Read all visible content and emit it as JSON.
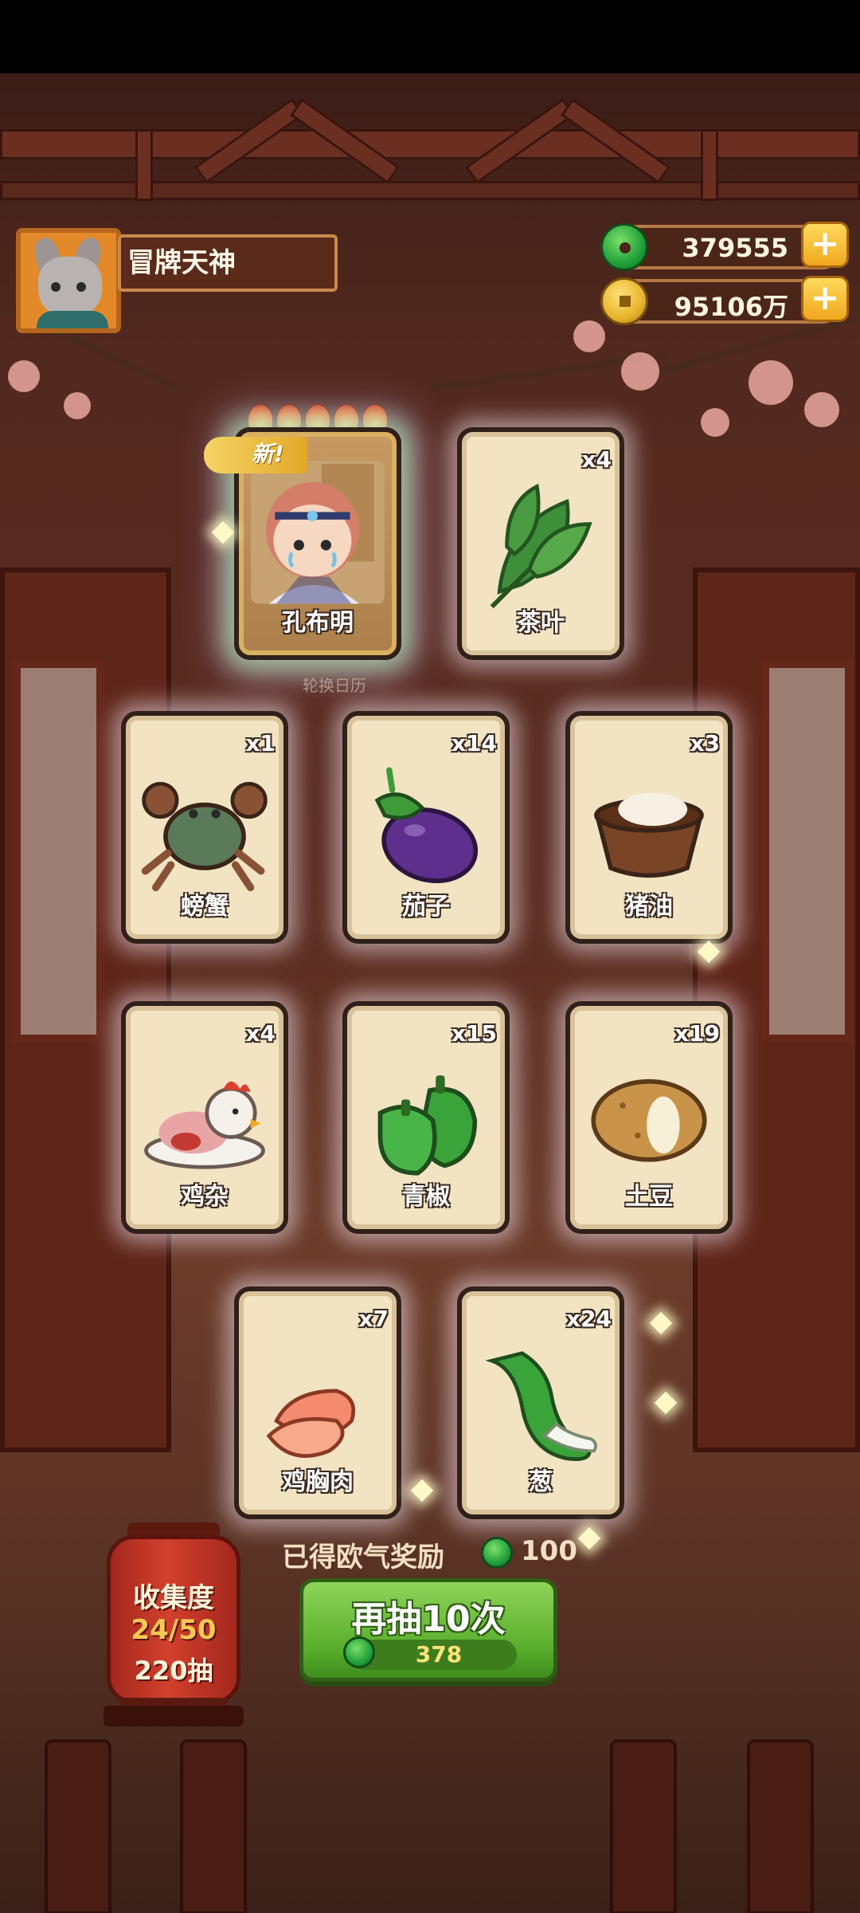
{
  "player": {
    "name": "冒牌天神",
    "avatar_icon": "wolf-avatar-icon"
  },
  "currency": {
    "jade_amount": "379555",
    "coin_amount": "95106万",
    "jade_icon": "jade-icon",
    "coin_icon": "coin-icon",
    "plus_label": "+"
  },
  "new_tag": "新!",
  "background_text": "轮换日历",
  "cards": [
    {
      "id": "kongbuming",
      "label": "孔布明",
      "count": "",
      "is_character": true,
      "is_new": true,
      "stars": 5
    },
    {
      "id": "tea",
      "label": "茶叶",
      "count": "x4",
      "icon": "tea-leaf-icon"
    },
    {
      "id": "crab",
      "label": "螃蟹",
      "count": "x1",
      "icon": "crab-icon"
    },
    {
      "id": "eggplant",
      "label": "茄子",
      "count": "x14",
      "icon": "eggplant-icon"
    },
    {
      "id": "lard",
      "label": "猪油",
      "count": "x3",
      "icon": "lard-icon"
    },
    {
      "id": "chicken-offal",
      "label": "鸡杂",
      "count": "x4",
      "icon": "chicken-offal-icon"
    },
    {
      "id": "green-pepper",
      "label": "青椒",
      "count": "x15",
      "icon": "green-pepper-icon"
    },
    {
      "id": "potato",
      "label": "土豆",
      "count": "x19",
      "icon": "potato-icon"
    },
    {
      "id": "chicken-breast",
      "label": "鸡胸肉",
      "count": "x7",
      "icon": "chicken-breast-icon"
    },
    {
      "id": "scallion",
      "label": "葱",
      "count": "x24",
      "icon": "scallion-icon"
    }
  ],
  "reward": {
    "text": "已得欧气奖励",
    "amount": "100"
  },
  "collection": {
    "title": "收集度",
    "progress": "24/50",
    "draws": "220抽"
  },
  "draw_button": {
    "label": "再抽10次",
    "cost": "378"
  },
  "colors": {
    "accent_green": "#59ad2c",
    "card_bg": "#f2e3c2",
    "lantern_red": "#d2402d",
    "gold": "#f0a81e"
  }
}
